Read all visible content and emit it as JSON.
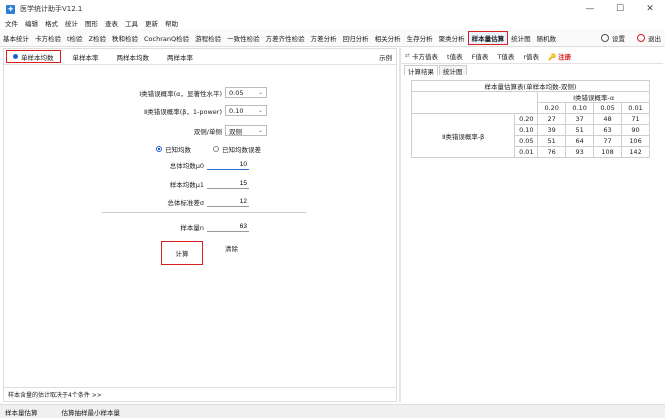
{
  "window": {
    "title": "医学统计助手V12.1",
    "controls": [
      "—",
      "☐",
      "✕"
    ]
  },
  "menu": [
    "文件",
    "编辑",
    "格式",
    "统计",
    "图形",
    "查表",
    "工具",
    "更新",
    "帮助"
  ],
  "toolbar": {
    "items": [
      "基本统计",
      "卡方检验",
      "t检验",
      "Z检验",
      "秩和检验",
      "CochranQ检验",
      "游程检验",
      "一致性检验",
      "方差齐性检验",
      "方差分析",
      "回归分析",
      "相关分析",
      "生存分析",
      "聚类分析",
      "样本量估算",
      "统计图",
      "随机数"
    ],
    "active": "样本量估算",
    "settings_label": "设置",
    "exit_label": "退出"
  },
  "left": {
    "tabs": [
      "单样本均数",
      "单样本率",
      "两样本均数",
      "两样本率"
    ],
    "active_tab": "单样本均数",
    "example_label": "示例",
    "alpha_label": "Ⅰ类错误概率(α，显著性水平)",
    "alpha_value": "0.05",
    "beta_label": "Ⅱ类错误概率(β，1-power)",
    "beta_value": "0.10",
    "sided_label": "双侧/单侧",
    "sided_value": "双侧",
    "radio_known_mean": "已知均数",
    "radio_known_err": "已知均数误差",
    "mu0_label": "总体均数μ0",
    "mu0_value": "10",
    "mu1_label": "样本均数μ1",
    "mu1_value": "15",
    "sigma_label": "总体标准差σ",
    "sigma_value": "12",
    "n_label": "样本量n",
    "n_value": "63",
    "calc_label": "计算",
    "clear_label": "清除",
    "status_note": "样本含量的估计取决于4个条件   >>"
  },
  "right": {
    "tools": [
      "卡方值表",
      "t值表",
      "F值表",
      "T值表",
      "r值表"
    ],
    "note_label": "注册",
    "tabs": [
      "计算结果",
      "统计图"
    ],
    "active_tab": "计算结果",
    "table": {
      "title": "样本量估算表(单样本均数-双侧)",
      "alpha_header": "Ⅰ类错误概率-α",
      "alphas": [
        "0.20",
        "0.10",
        "0.05",
        "0.01"
      ],
      "row_header": "Ⅱ类错误概率-β",
      "rows": [
        {
          "beta": "0.20",
          "values": [
            "27",
            "37",
            "48",
            "71"
          ]
        },
        {
          "beta": "0.10",
          "values": [
            "39",
            "51",
            "63",
            "90"
          ]
        },
        {
          "beta": "0.05",
          "values": [
            "51",
            "64",
            "77",
            "106"
          ]
        },
        {
          "beta": "0.01",
          "values": [
            "76",
            "93",
            "108",
            "142"
          ]
        }
      ]
    }
  },
  "statusbar": {
    "left": "样本量估算",
    "right": "估算抽样最小样本量"
  }
}
